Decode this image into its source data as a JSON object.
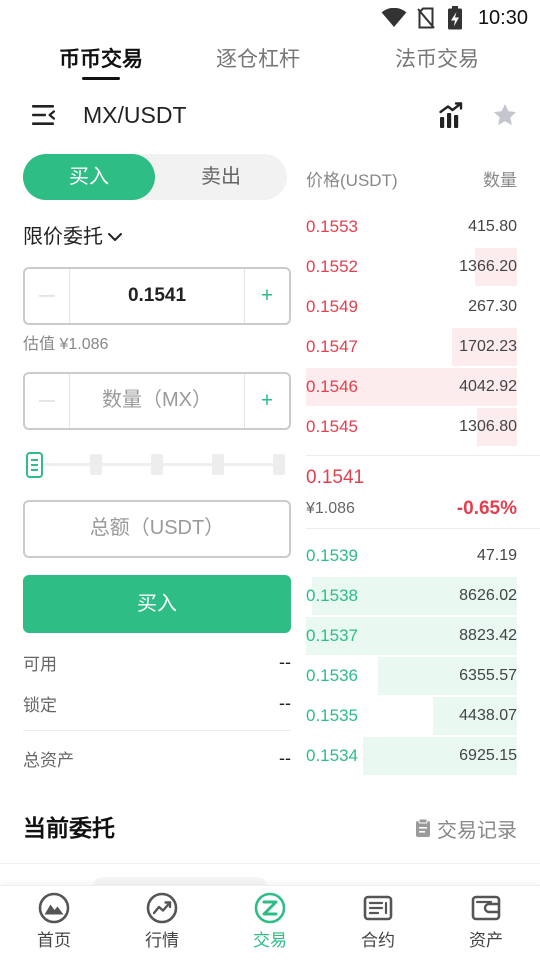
{
  "status_bar": {
    "time": "10:30",
    "icons": [
      "wifi-icon",
      "no-sim-icon",
      "battery-charging-icon"
    ]
  },
  "top_tabs": [
    {
      "label": "币币交易",
      "active": true
    },
    {
      "label": "逐仓杠杆",
      "active": false
    },
    {
      "label": "法币交易",
      "active": false
    }
  ],
  "header": {
    "pair": "MX/USDT",
    "menu_icon": "menu-icon",
    "chart_icon": "kline-chart-icon",
    "favorite_icon": "star-icon"
  },
  "order_form": {
    "side_tabs": [
      {
        "label": "买入",
        "active": true
      },
      {
        "label": "卖出",
        "active": false
      }
    ],
    "order_type": "限价委托",
    "decrement_symbol": "—",
    "increment_symbol": "+",
    "price_value": "0.1541",
    "estimate_label": "估值",
    "estimate_value": "¥1.086",
    "amount_placeholder": "数量（MX）",
    "slider_percent": 0,
    "total_placeholder": "总额（USDT）",
    "submit_label": "买入",
    "available_label": "可用",
    "available_value": "--",
    "locked_label": "锁定",
    "locked_value": "--",
    "total_assets_label": "总资产",
    "total_assets_value": "--"
  },
  "order_book": {
    "price_header": "价格(USDT)",
    "amount_header": "数量",
    "asks": [
      {
        "price": "0.1553",
        "amount": "415.80",
        "depth": 0
      },
      {
        "price": "0.1552",
        "amount": "1366.20",
        "depth": 0.2
      },
      {
        "price": "0.1549",
        "amount": "267.30",
        "depth": 0
      },
      {
        "price": "0.1547",
        "amount": "1702.23",
        "depth": 0.31
      },
      {
        "price": "0.1546",
        "amount": "4042.92",
        "depth": 1
      },
      {
        "price": "0.1545",
        "amount": "1306.80",
        "depth": 0.19
      }
    ],
    "last_price": "0.1541",
    "last_price_cny": "¥1.086",
    "change": "-0.65%",
    "bids": [
      {
        "price": "0.1539",
        "amount": "47.19",
        "depth": 0
      },
      {
        "price": "0.1538",
        "amount": "8626.02",
        "depth": 0.97
      },
      {
        "price": "0.1537",
        "amount": "8823.42",
        "depth": 1
      },
      {
        "price": "0.1536",
        "amount": "6355.57",
        "depth": 0.66
      },
      {
        "price": "0.1535",
        "amount": "4438.07",
        "depth": 0.4
      },
      {
        "price": "0.1534",
        "amount": "6925.15",
        "depth": 0.73
      }
    ]
  },
  "open_orders": {
    "title": "当前委托",
    "history_label": "交易记录",
    "history_icon": "clipboard-icon"
  },
  "bottom_nav": [
    {
      "label": "首页",
      "icon": "home-icon",
      "active": false
    },
    {
      "label": "行情",
      "icon": "market-icon",
      "active": false
    },
    {
      "label": "交易",
      "icon": "trade-icon",
      "active": true
    },
    {
      "label": "合约",
      "icon": "contract-icon",
      "active": false
    },
    {
      "label": "资产",
      "icon": "assets-icon",
      "active": false
    }
  ],
  "colors": {
    "green": "#2ebd85",
    "red": "#e2404f",
    "ask_depth": "#fdecee",
    "bid_depth": "#eaf8f2",
    "text": "#222222",
    "muted": "#8a8a8a"
  }
}
